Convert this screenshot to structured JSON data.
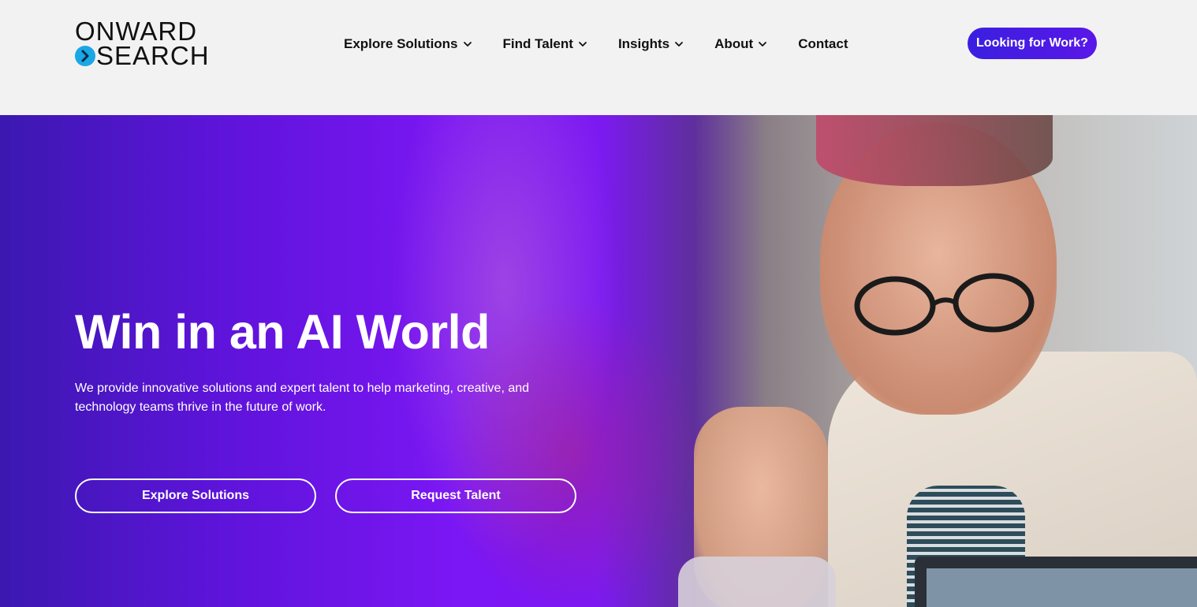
{
  "brand": {
    "logo_line1": "ONWARD",
    "logo_line2": "SEARCH",
    "accent": "#1aa7e6"
  },
  "nav": {
    "items": [
      {
        "label": "Explore Solutions",
        "has_dropdown": true
      },
      {
        "label": "Find Talent",
        "has_dropdown": true
      },
      {
        "label": "Insights",
        "has_dropdown": true
      },
      {
        "label": "About",
        "has_dropdown": true
      },
      {
        "label": "Contact",
        "has_dropdown": false
      }
    ],
    "cta_label": "Looking for Work?",
    "cta_color": "#3a1fe0"
  },
  "hero": {
    "title": "Win in an AI World",
    "subtitle": "We provide innovative solutions and expert talent to help marketing, creative, and technology teams thrive in the future of work.",
    "buttons": [
      {
        "label": "Explore Solutions"
      },
      {
        "label": "Request Talent"
      }
    ],
    "gradient_start": "#3b18b0",
    "gradient_mid": "#7b16f4"
  }
}
